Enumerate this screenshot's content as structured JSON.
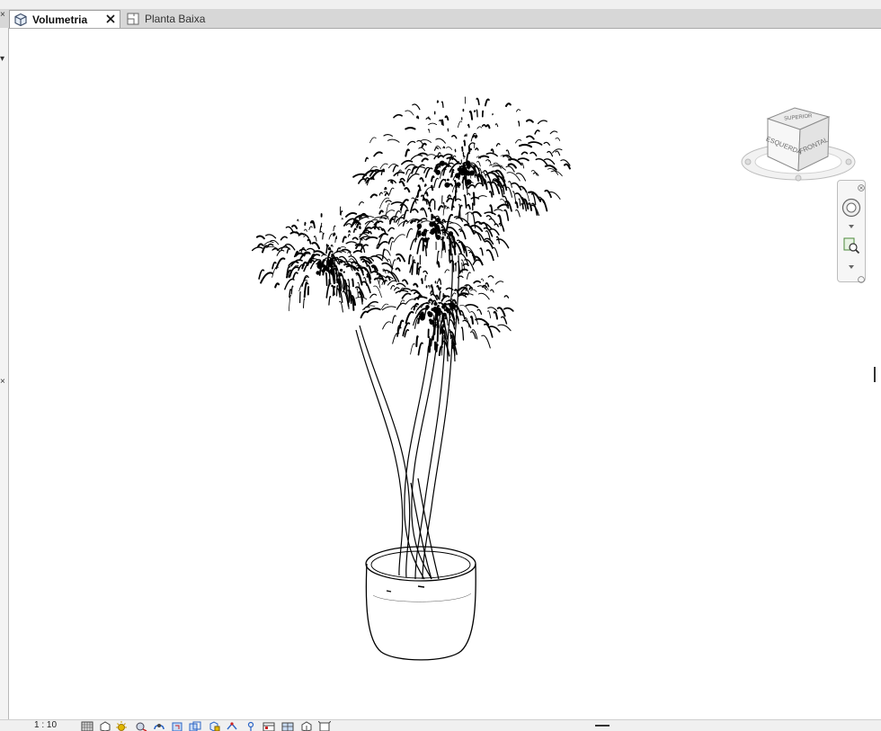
{
  "tabs": [
    {
      "label": "Volumetria",
      "icon": "3d-view-icon",
      "active": true
    },
    {
      "label": "Planta Baixa",
      "icon": "floor-plan-icon",
      "active": false
    }
  ],
  "viewcube": {
    "top_label": "SUPERIOR",
    "left_label": "ESQUERDA",
    "front_label": "FRONTAL"
  },
  "status": {
    "scale": "1 : 10",
    "icons": [
      "detail-level-icon",
      "visual-style-icon",
      "sun-path-icon",
      "shadows-icon",
      "render-icon",
      "crop-view-icon",
      "show-crop-icon",
      "unlock-3d-icon",
      "temporary-hide-icon",
      "reveal-hidden-icon",
      "worksharing-icon",
      "analytical-model-icon",
      "highlight-displacement-icon",
      "constraints-icon",
      "design-options-icon"
    ]
  },
  "colors": {
    "tab_bar": "#d7d7d7",
    "line_art": "#000000",
    "accent_red": "#cc2222",
    "accent_blue": "#2a64c5",
    "accent_yellow": "#e2b800"
  }
}
